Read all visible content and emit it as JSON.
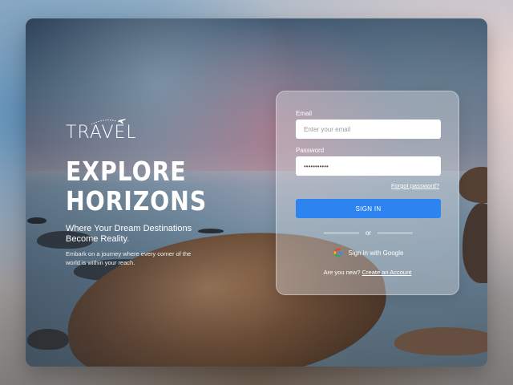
{
  "brand": {
    "name": "TRAVEL",
    "icon": "airplane-icon"
  },
  "hero": {
    "headline_line1": "EXPLORE",
    "headline_line2": "HORIZONS",
    "subtitle": "Where Your Dream Destinations Become Reality.",
    "description": "Embark on a journey where every corner of the world is within your reach."
  },
  "login": {
    "email_label": "Email",
    "email_placeholder": "Enter your email",
    "email_value": "",
    "password_label": "Password",
    "password_value": "•••••••••••",
    "forgot_link": "Forgot password?",
    "signin_button": "SIGN IN",
    "divider_text": "or",
    "google_button": "Sign in with Google",
    "google_icon": "google-icon",
    "register_prompt": "Are you new?",
    "register_link": "Create an Account"
  },
  "colors": {
    "accent": "#2d84f0",
    "panel": "rgba(225,228,235,0.38)",
    "text": "#ffffff"
  }
}
